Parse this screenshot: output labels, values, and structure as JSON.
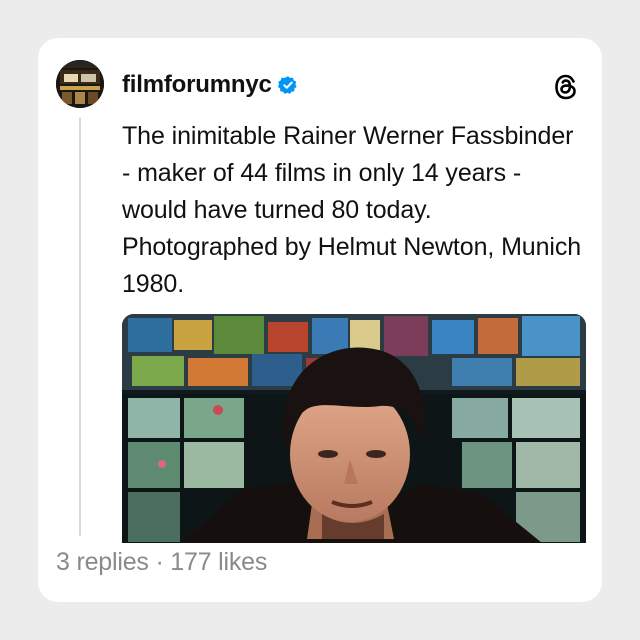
{
  "post": {
    "username": "filmforumnyc",
    "verified": true,
    "text": "The inimitable Rainer Werner Fassbinder - maker of 44 films in only 14 years - would have turned 80 today. Photographed by Helmut Newton, Munich 1980.",
    "stats": "3 replies · 177 likes"
  },
  "icons": {
    "verified": "verified-badge-icon",
    "app": "threads-logo-icon"
  },
  "colors": {
    "verified": "#0095f6",
    "text": "#111111",
    "muted": "#8a8a8a"
  }
}
